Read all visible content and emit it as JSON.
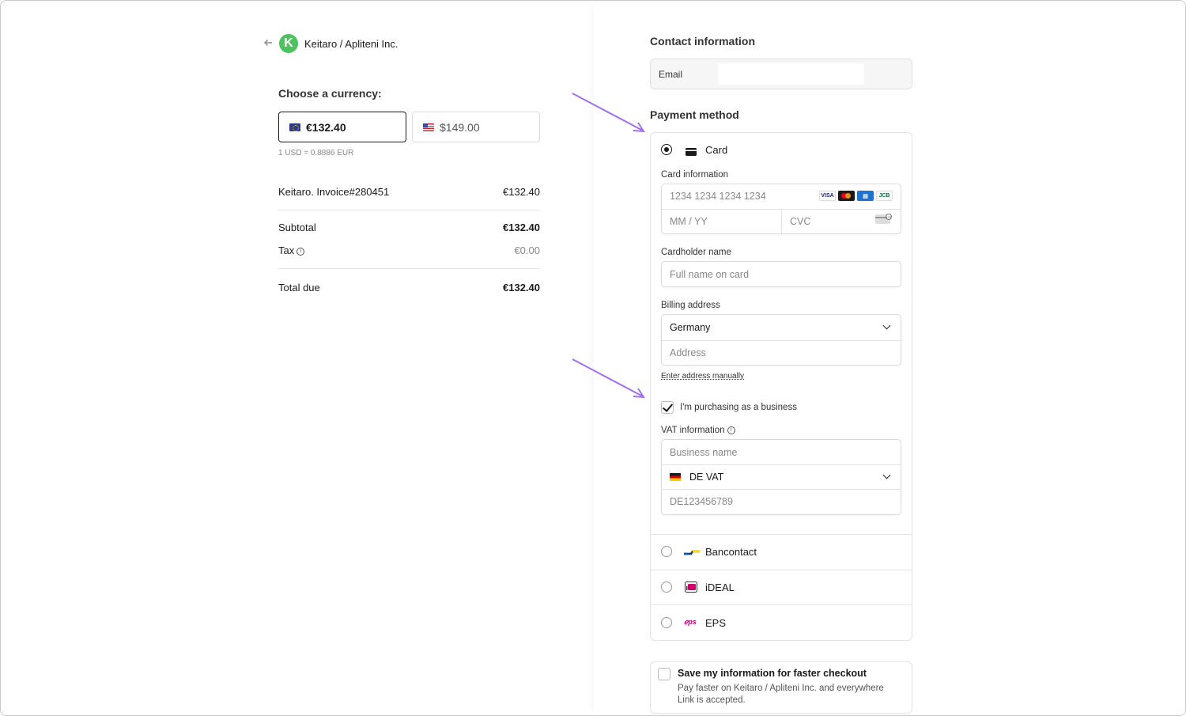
{
  "merchant": {
    "back_icon": "arrow-left-icon",
    "logo_letter": "K",
    "name": "Keitaro / Apliteni Inc."
  },
  "currency": {
    "heading": "Choose a currency:",
    "options": [
      {
        "label": "€132.40",
        "flag": "eu-flag-icon",
        "selected": true
      },
      {
        "label": "$149.00",
        "flag": "us-flag-icon",
        "selected": false
      }
    ],
    "rate": "1 USD = 0.8886 EUR"
  },
  "summary": {
    "item_name": "Keitaro. Invoice#280451",
    "item_amount": "€132.40",
    "subtotal_label": "Subtotal",
    "subtotal_amount": "€132.40",
    "tax_label": "Tax",
    "tax_amount": "€0.00",
    "total_label": "Total due",
    "total_amount": "€132.40"
  },
  "contact": {
    "heading": "Contact information",
    "email_label": "Email",
    "email_value": ""
  },
  "payment": {
    "heading": "Payment method",
    "card_label": "Card",
    "card_info_label": "Card information",
    "card_number_placeholder": "1234 1234 1234 1234",
    "card_brands": [
      "VISA",
      "MC",
      "AMEX",
      "JCB"
    ],
    "expiry_placeholder": "MM / YY",
    "cvc_placeholder": "CVC",
    "cardholder_label": "Cardholder name",
    "cardholder_placeholder": "Full name on card",
    "billing_label": "Billing address",
    "country_value": "Germany",
    "address_placeholder": "Address",
    "enter_manually": "Enter address manually",
    "business_checkbox_label": "I'm purchasing as a business",
    "vat_label": "VAT information",
    "business_name_placeholder": "Business name",
    "vat_type_value": "DE VAT",
    "vat_number_placeholder": "DE123456789",
    "other_methods": [
      "Bancontact",
      "iDEAL",
      "EPS"
    ]
  },
  "save_info": {
    "title": "Save my information for faster checkout",
    "description": "Pay faster on Keitaro / Apliteni Inc. and everywhere Link is accepted."
  },
  "colors": {
    "accent_green": "#4cc35e",
    "annotation_arrow": "#a070ee"
  }
}
